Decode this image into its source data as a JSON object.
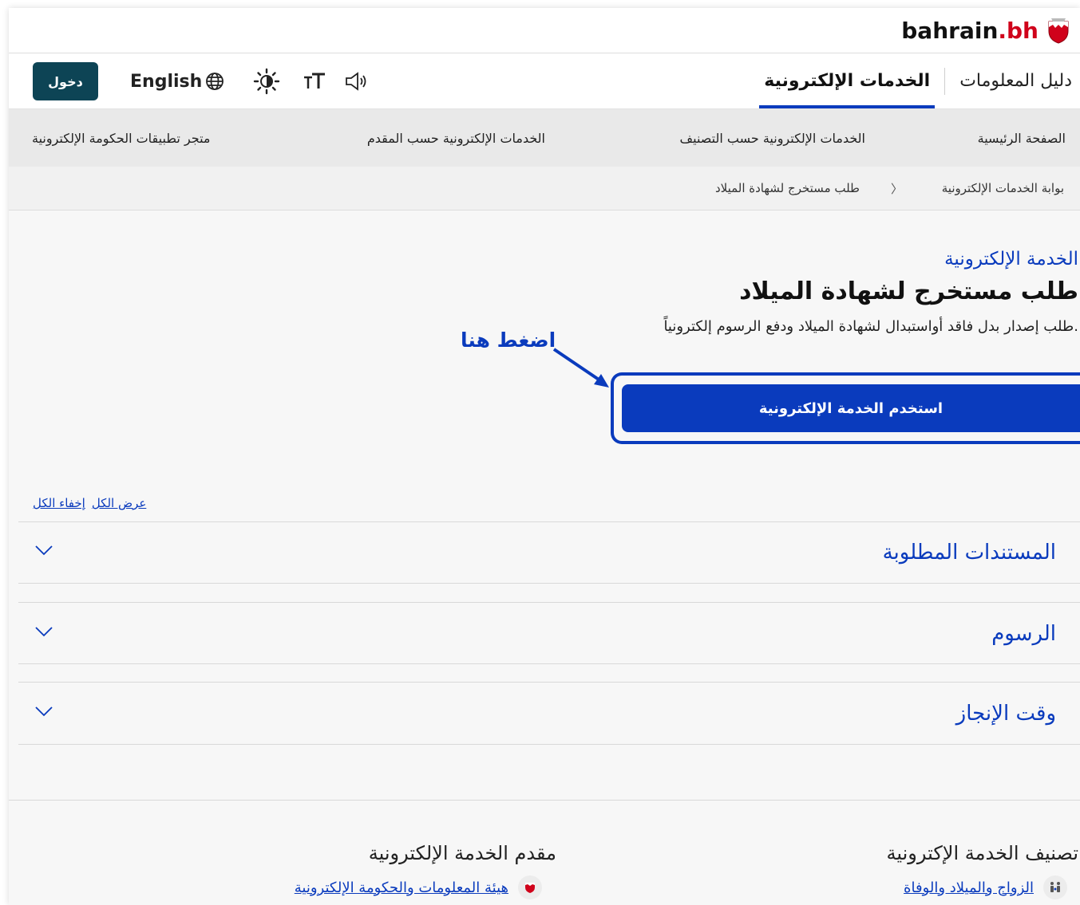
{
  "brand": {
    "name": "bahrain",
    "tld": ".bh",
    "icon": "bahrain-emblem-icon"
  },
  "topnav": {
    "tabs": [
      {
        "label": "دليل المعلومات",
        "active": false
      },
      {
        "label": "الخدمات الإلكترونية",
        "active": true
      }
    ],
    "login_label": "دخول",
    "language_label": "English",
    "tool_icons": [
      "brightness-icon",
      "text-size-icon",
      "speaker-icon",
      "globe-icon"
    ]
  },
  "subnav": {
    "items": [
      "الصفحة الرئيسية",
      "الخدمات الإلكترونية حسب التصنيف",
      "الخدمات الإلكترونية حسب المقدم",
      "متجر تطبيقات الحكومة الإلكترونية"
    ]
  },
  "breadcrumb": {
    "items": [
      "بوابة الخدمات الإلكترونية",
      "طلب مستخرج لشهادة الميلاد"
    ],
    "separator": "〉"
  },
  "service": {
    "kicker": "الخدمة الإلكترونية",
    "title": "طلب مستخرج لشهادة الميلاد",
    "description": "طلب إصدار بدل فاقد أواستبدال لشهادة الميلاد ودفع الرسوم إلكترونياً.",
    "cta_label": "استخدم الخدمة الإلكترونية"
  },
  "annotation": {
    "text": "اضغط هنا",
    "color": "#0a3bbd"
  },
  "accordion": {
    "show_all": "عرض الكل",
    "hide_all": "إخفاء الكل",
    "sections": [
      {
        "title": "المستندات المطلوبة",
        "expanded": false
      },
      {
        "title": "الرسوم",
        "expanded": false
      },
      {
        "title": "وقت الإنجاز",
        "expanded": false
      }
    ]
  },
  "footer": {
    "category_heading": "تصنيف الخدمة الإكترونية",
    "category_link": "الزواج والميلاد والوفاة",
    "provider_heading": "مقدم الخدمة الإلكترونية",
    "provider_link": "هيئة المعلومات والحكومة الإلكترونية"
  },
  "colors": {
    "accent": "#0a3bbd",
    "login_bg": "#0d4455",
    "brand_red": "#d0021b"
  }
}
